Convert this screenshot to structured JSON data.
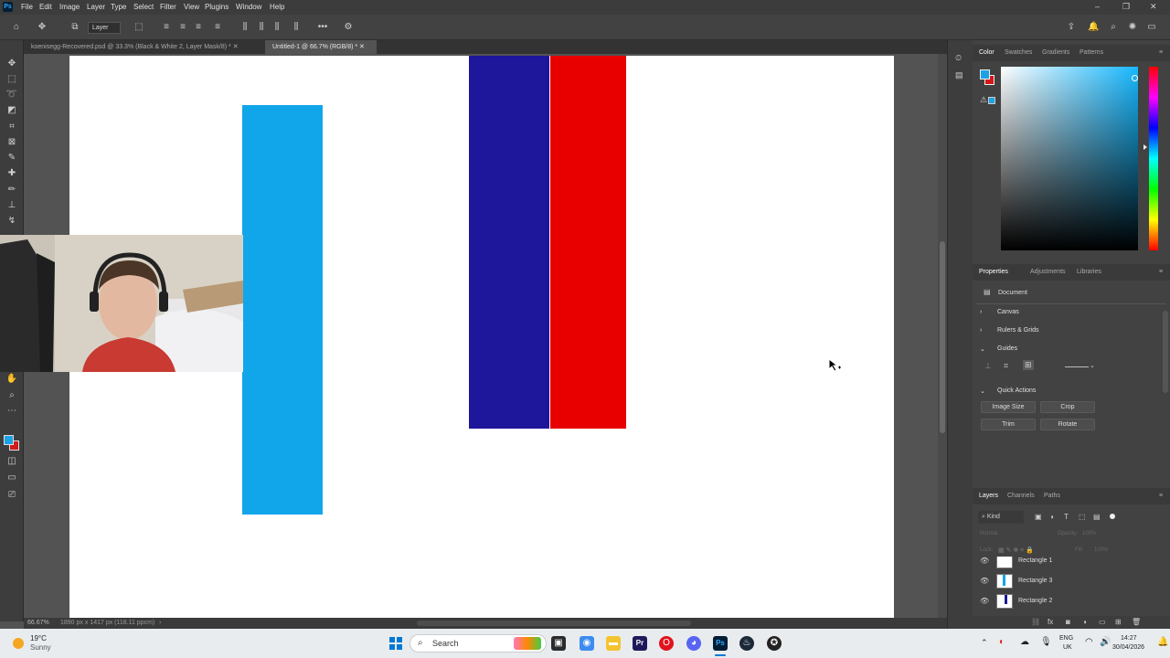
{
  "menubar": {
    "app_logo": "Ps",
    "items": [
      "File",
      "Edit",
      "Image",
      "Layer",
      "Type",
      "Select",
      "Filter",
      "View",
      "Plugins",
      "Window",
      "Help"
    ],
    "window_controls": [
      "–",
      "❐",
      "✕"
    ]
  },
  "optionsbar": {
    "layer_select": "Layer"
  },
  "tabs": [
    {
      "label": "koenisegg-Recovered.psd @ 33.3% (Black & White 2, Layer Mask/8) *",
      "active": false
    },
    {
      "label": "Untitled-1 @ 66.7% (RGB/8) *",
      "active": true
    }
  ],
  "canvas": {
    "shapes": [
      {
        "name": "light-blue-rectangle",
        "color": "#11a6ea"
      },
      {
        "name": "dark-blue-rectangle",
        "color": "#1e169b"
      },
      {
        "name": "red-rectangle",
        "color": "#e80000"
      }
    ]
  },
  "statusbar": {
    "zoom": "66.67%",
    "doc_info": "1890 px x 1417 px (118.11 ppcm)"
  },
  "color_panel": {
    "tabs": [
      "Color",
      "Swatches",
      "Gradients",
      "Patterns"
    ],
    "active_tab": "Color",
    "foreground": "#1ba3e6",
    "background": "#d21a1a",
    "picker_hue": "#17b8ff"
  },
  "properties_panel": {
    "tabs": [
      "Properties",
      "Adjustments",
      "Libraries"
    ],
    "active_tab": "Properties",
    "doc_label": "Document",
    "sections": [
      "Canvas",
      "Rulers & Grids",
      "Guides",
      "Quick Actions"
    ],
    "quick_actions": [
      "Image Size",
      "Crop",
      "Trim",
      "Rotate"
    ]
  },
  "layers_panel": {
    "tabs": [
      "Layers",
      "Channels",
      "Paths"
    ],
    "active_tab": "Layers",
    "filter_label": "Kind",
    "blend_mode": "Normal",
    "opacity_label": "Opacity:",
    "opacity_value": "100%",
    "lock_label": "Lock:",
    "fill_label": "Fill:",
    "fill_value": "100%",
    "layers": [
      {
        "name": "Rectangle 1"
      },
      {
        "name": "Rectangle 3"
      },
      {
        "name": "Rectangle 2"
      }
    ]
  },
  "taskbar": {
    "weather_temp": "19°C",
    "weather_desc": "Sunny",
    "search_label": "Search",
    "lang_line1": "ENG",
    "lang_line2": "UK",
    "time": "14:27",
    "date": "30/04/2026"
  }
}
